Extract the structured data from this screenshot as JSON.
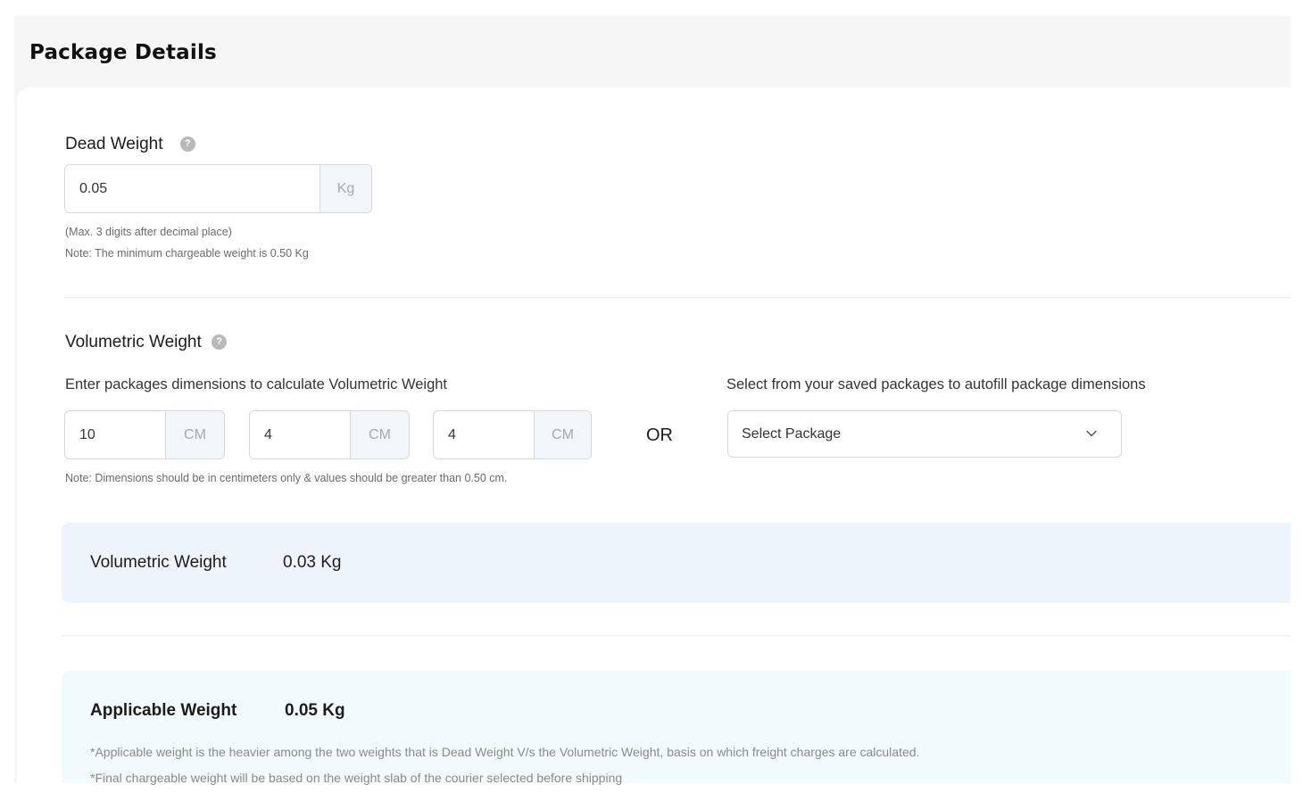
{
  "header": {
    "title": "Package Details"
  },
  "dead_weight": {
    "title": "Dead Weight",
    "help_icon": "question-circle-icon",
    "value": "0.05",
    "unit": "Kg",
    "hint1": "(Max. 3 digits after decimal place)",
    "hint2": "Note: The minimum chargeable weight is 0.50 Kg"
  },
  "volumetric": {
    "title": "Volumetric Weight",
    "help_icon": "question-circle-icon",
    "instruction": "Enter packages dimensions to calculate Volumetric Weight",
    "length": {
      "value": "10",
      "unit": "CM"
    },
    "breadth": {
      "value": "4",
      "unit": "CM"
    },
    "height": {
      "value": "4",
      "unit": "CM"
    },
    "or_label": "OR",
    "saved_label": "Select from your saved packages to autofill package dimensions",
    "select_placeholder": "Select Package",
    "dimension_note": "Note: Dimensions should be in centimeters only & values should be greater than 0.50 cm.",
    "result_label": "Volumetric Weight",
    "result_value": "0.03 Kg"
  },
  "applicable": {
    "label": "Applicable Weight",
    "value": "0.05 Kg",
    "note1": "*Applicable weight is the heavier among the two weights that is Dead Weight V/s the Volumetric Weight, basis on which freight charges are calculated.",
    "note2": "*Final chargeable weight will be based on the weight slab of the courier selected before shipping"
  },
  "colors": {
    "volumetric_panel_bg": "#eef4fb",
    "applicable_panel_bg": "#f1fbfd",
    "unit_bg": "#f2f5f9"
  }
}
